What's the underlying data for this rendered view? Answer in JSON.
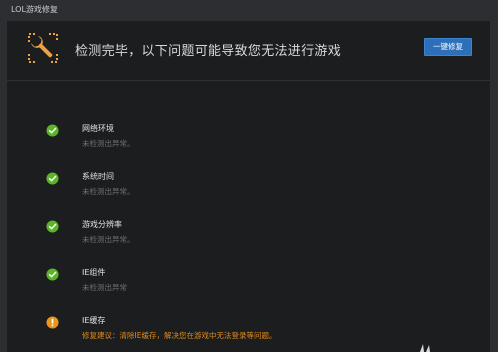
{
  "window": {
    "title": "LOL游戏修复"
  },
  "header": {
    "icon": "wrench-icon",
    "message": "检测完毕，以下问题可能导致您无法进行游戏",
    "fix_button_label": "一键修复"
  },
  "colors": {
    "ok": "#5cb42a",
    "warning": "#e8961e",
    "button": "#2d6fb8",
    "icon_orange": "#f0a040"
  },
  "items": [
    {
      "icon": "check-icon",
      "title": "网络环境",
      "status": "未检测出异常。",
      "state": "ok"
    },
    {
      "icon": "check-icon",
      "title": "系统时间",
      "status": "未检测出异常。",
      "state": "ok"
    },
    {
      "icon": "check-icon",
      "title": "游戏分辨率",
      "status": "未检测出异常。",
      "state": "ok"
    },
    {
      "icon": "check-icon",
      "title": "IE组件",
      "status": "未检测出异常",
      "state": "ok"
    },
    {
      "icon": "warning-icon",
      "title": "IE缓存",
      "status": "修复建议：清除IE缓存，解决您在游戏中无法登录等问题。",
      "state": "warning"
    }
  ]
}
